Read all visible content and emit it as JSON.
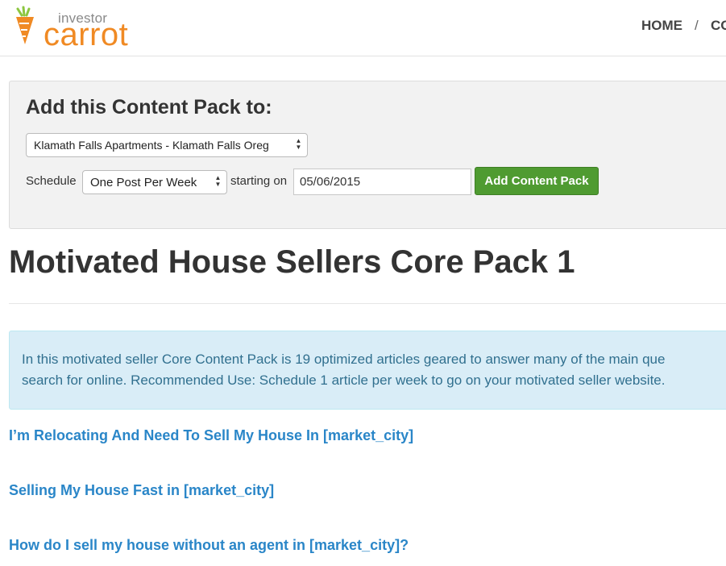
{
  "header": {
    "logo_small": "investor",
    "logo_big": "carrot",
    "logo_colors": {
      "carrot": "#f08a24",
      "leaf": "#8cc63f"
    },
    "nav": [
      {
        "label": "HOME"
      },
      {
        "label": "/"
      },
      {
        "label": "CO"
      }
    ]
  },
  "panel": {
    "title": "Add this Content Pack to:",
    "site_select_value": "Klamath Falls Apartments - Klamath Falls Oreg",
    "schedule_label": "Schedule",
    "schedule_value": "One Post Per Week",
    "starting_label": "starting on",
    "start_date": "05/06/2015",
    "add_button": "Add Content Pack",
    "button_color": "#4f9b31"
  },
  "main": {
    "title": "Motivated House Sellers Core Pack 1",
    "info_line1": "In this motivated seller Core Content Pack is 19 optimized articles geared to answer many of the main que",
    "info_line2": "search for online. Recommended Use: Schedule 1 article per week to go on your motivated seller website.",
    "articles": [
      {
        "title": "I’m Relocating And Need To Sell My House In [market_city]"
      },
      {
        "title": "Selling My House Fast in [market_city]"
      },
      {
        "title": "How do I sell my house without an agent in [market_city]?"
      }
    ]
  }
}
